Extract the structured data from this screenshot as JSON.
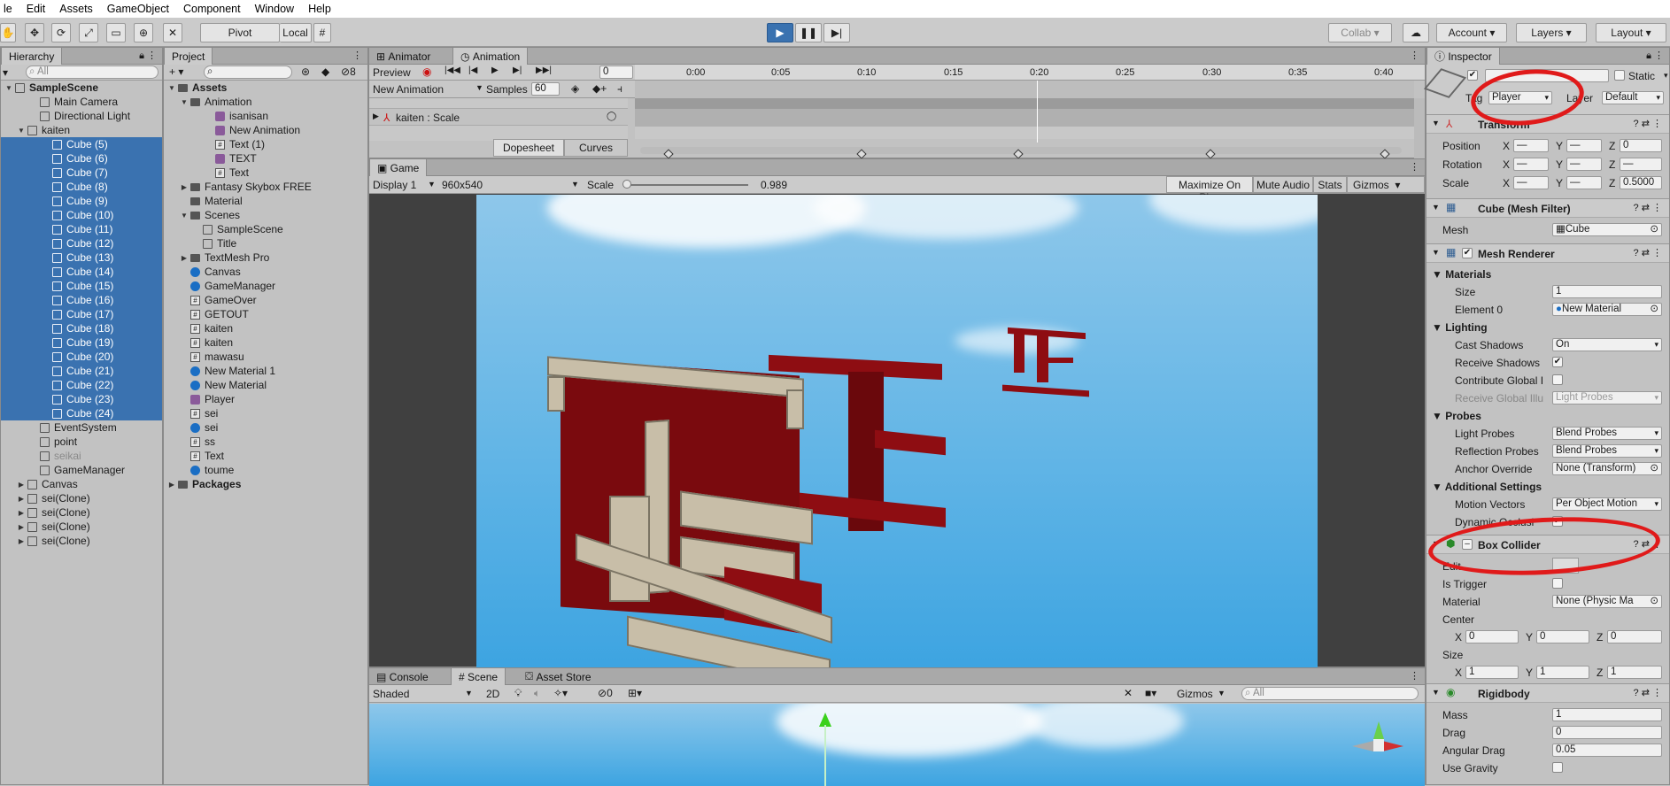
{
  "menu": [
    "le",
    "Edit",
    "Assets",
    "GameObject",
    "Component",
    "Window",
    "Help"
  ],
  "toolbar": {
    "pivot": "Pivot",
    "local": "Local",
    "collab": "Collab ▾",
    "account": "Account",
    "layers": "Layers",
    "layout": "Layout"
  },
  "hierarchy": {
    "title": "Hierarchy",
    "search": "All",
    "rows": [
      {
        "label": "SampleScene",
        "bold": true,
        "indent": 0,
        "arrow": "▼",
        "sel": false,
        "icon": "cube"
      },
      {
        "label": "Main Camera",
        "indent": 2,
        "arrow": "",
        "sel": false,
        "icon": "cube"
      },
      {
        "label": "Directional Light",
        "indent": 2,
        "arrow": "",
        "sel": false,
        "icon": "cube"
      },
      {
        "label": "kaiten",
        "indent": 1,
        "arrow": "▼",
        "sel": false,
        "icon": "cube"
      },
      {
        "label": "Cube (5)",
        "indent": 3,
        "arrow": "",
        "sel": true,
        "icon": "cube"
      },
      {
        "label": "Cube (6)",
        "indent": 3,
        "arrow": "",
        "sel": true,
        "icon": "cube"
      },
      {
        "label": "Cube (7)",
        "indent": 3,
        "arrow": "",
        "sel": true,
        "icon": "cube"
      },
      {
        "label": "Cube (8)",
        "indent": 3,
        "arrow": "",
        "sel": true,
        "icon": "cube"
      },
      {
        "label": "Cube (9)",
        "indent": 3,
        "arrow": "",
        "sel": true,
        "icon": "cube"
      },
      {
        "label": "Cube (10)",
        "indent": 3,
        "arrow": "",
        "sel": true,
        "icon": "cube"
      },
      {
        "label": "Cube (11)",
        "indent": 3,
        "arrow": "",
        "sel": true,
        "icon": "cube"
      },
      {
        "label": "Cube (12)",
        "indent": 3,
        "arrow": "",
        "sel": true,
        "icon": "cube"
      },
      {
        "label": "Cube (13)",
        "indent": 3,
        "arrow": "",
        "sel": true,
        "icon": "cube"
      },
      {
        "label": "Cube (14)",
        "indent": 3,
        "arrow": "",
        "sel": true,
        "icon": "cube"
      },
      {
        "label": "Cube (15)",
        "indent": 3,
        "arrow": "",
        "sel": true,
        "icon": "cube"
      },
      {
        "label": "Cube (16)",
        "indent": 3,
        "arrow": "",
        "sel": true,
        "icon": "cube"
      },
      {
        "label": "Cube (17)",
        "indent": 3,
        "arrow": "",
        "sel": true,
        "icon": "cube"
      },
      {
        "label": "Cube (18)",
        "indent": 3,
        "arrow": "",
        "sel": true,
        "icon": "cube"
      },
      {
        "label": "Cube (19)",
        "indent": 3,
        "arrow": "",
        "sel": true,
        "icon": "cube"
      },
      {
        "label": "Cube (20)",
        "indent": 3,
        "arrow": "",
        "sel": true,
        "icon": "cube"
      },
      {
        "label": "Cube (21)",
        "indent": 3,
        "arrow": "",
        "sel": true,
        "icon": "cube"
      },
      {
        "label": "Cube (22)",
        "indent": 3,
        "arrow": "",
        "sel": true,
        "icon": "cube"
      },
      {
        "label": "Cube (23)",
        "indent": 3,
        "arrow": "",
        "sel": true,
        "icon": "cube"
      },
      {
        "label": "Cube (24)",
        "indent": 3,
        "arrow": "",
        "sel": true,
        "icon": "cube"
      },
      {
        "label": "EventSystem",
        "indent": 2,
        "arrow": "",
        "sel": false,
        "icon": "cube"
      },
      {
        "label": "point",
        "indent": 2,
        "arrow": "",
        "sel": false,
        "icon": "cube"
      },
      {
        "label": "seikai",
        "indent": 2,
        "arrow": "",
        "sel": false,
        "icon": "cube",
        "dim": true
      },
      {
        "label": "GameManager",
        "indent": 2,
        "arrow": "",
        "sel": false,
        "icon": "cube"
      },
      {
        "label": "Canvas",
        "indent": 1,
        "arrow": "▶",
        "sel": false,
        "icon": "cube"
      },
      {
        "label": "sei(Clone)",
        "indent": 1,
        "arrow": "▶",
        "sel": false,
        "icon": "cube"
      },
      {
        "label": "sei(Clone)",
        "indent": 1,
        "arrow": "▶",
        "sel": false,
        "icon": "cube"
      },
      {
        "label": "sei(Clone)",
        "indent": 1,
        "arrow": "▶",
        "sel": false,
        "icon": "cube"
      },
      {
        "label": "sei(Clone)",
        "indent": 1,
        "arrow": "▶",
        "sel": false,
        "icon": "cube"
      }
    ]
  },
  "project": {
    "title": "Project",
    "add": "+ ▾",
    "hidden_count": "8",
    "rows": [
      {
        "label": "Assets",
        "bold": true,
        "indent": 0,
        "arrow": "▼",
        "icon": "folder"
      },
      {
        "label": "Animation",
        "indent": 1,
        "arrow": "▼",
        "icon": "folder"
      },
      {
        "label": "isanisan",
        "indent": 3,
        "arrow": "",
        "icon": "anim"
      },
      {
        "label": "New Animation",
        "indent": 3,
        "arrow": "",
        "icon": "anim"
      },
      {
        "label": "Text (1)",
        "indent": 3,
        "arrow": "",
        "icon": "script"
      },
      {
        "label": "TEXT",
        "indent": 3,
        "arrow": "",
        "icon": "anim"
      },
      {
        "label": "Text",
        "indent": 3,
        "arrow": "",
        "icon": "script"
      },
      {
        "label": "Fantasy Skybox FREE",
        "indent": 1,
        "arrow": "▶",
        "icon": "folder"
      },
      {
        "label": "Material",
        "indent": 1,
        "arrow": "",
        "icon": "folder"
      },
      {
        "label": "Scenes",
        "indent": 1,
        "arrow": "▼",
        "icon": "folder"
      },
      {
        "label": "SampleScene",
        "indent": 2,
        "arrow": "",
        "icon": "cube"
      },
      {
        "label": "Title",
        "indent": 2,
        "arrow": "",
        "icon": "cube"
      },
      {
        "label": "TextMesh Pro",
        "indent": 1,
        "arrow": "▶",
        "icon": "folder"
      },
      {
        "label": "Canvas",
        "indent": 1,
        "arrow": "",
        "icon": "sphere"
      },
      {
        "label": "GameManager",
        "indent": 1,
        "arrow": "",
        "icon": "sphere"
      },
      {
        "label": "GameOver",
        "indent": 1,
        "arrow": "",
        "icon": "script"
      },
      {
        "label": "GETOUT",
        "indent": 1,
        "arrow": "",
        "icon": "script"
      },
      {
        "label": "kaiten",
        "indent": 1,
        "arrow": "",
        "icon": "script"
      },
      {
        "label": "kaiten",
        "indent": 1,
        "arrow": "",
        "icon": "script"
      },
      {
        "label": "mawasu",
        "indent": 1,
        "arrow": "",
        "icon": "script"
      },
      {
        "label": "New Material 1",
        "indent": 1,
        "arrow": "",
        "icon": "sphere"
      },
      {
        "label": "New Material",
        "indent": 1,
        "arrow": "",
        "icon": "sphere"
      },
      {
        "label": "Player",
        "indent": 1,
        "arrow": "",
        "icon": "anim"
      },
      {
        "label": "sei",
        "indent": 1,
        "arrow": "",
        "icon": "script"
      },
      {
        "label": "sei",
        "indent": 1,
        "arrow": "",
        "icon": "sphere"
      },
      {
        "label": "ss",
        "indent": 1,
        "arrow": "",
        "icon": "script"
      },
      {
        "label": "Text",
        "indent": 1,
        "arrow": "",
        "icon": "script"
      },
      {
        "label": "toume",
        "indent": 1,
        "arrow": "",
        "icon": "sphere"
      },
      {
        "label": "Packages",
        "bold": true,
        "indent": 0,
        "arrow": "▶",
        "icon": "folder"
      }
    ]
  },
  "animation": {
    "tab_animator": "Animator",
    "tab_animation": "Animation",
    "preview": "Preview",
    "frame": "0",
    "clip": "New Animation",
    "samples_label": "Samples",
    "samples": "60",
    "property": "kaiten : Scale",
    "dopesheet": "Dopesheet",
    "curves": "Curves",
    "times": [
      "0:00",
      "0:05",
      "0:10",
      "0:15",
      "0:20",
      "0:25",
      "0:30",
      "0:35",
      "0:40"
    ]
  },
  "game": {
    "tab": "Game",
    "display": "Display 1",
    "resolution": "960x540",
    "scale_label": "Scale",
    "scale_value": "0.989",
    "maximize": "Maximize On Play",
    "mute": "Mute Audio",
    "stats": "Stats",
    "gizmos": "Gizmos"
  },
  "scene": {
    "tab_console": "Console",
    "tab_scene": "Scene",
    "tab_store": "Asset Store",
    "shading": "Shaded",
    "mode2d": "2D",
    "hidden": "0",
    "gizmos": "Gizmos",
    "search": "All"
  },
  "inspector": {
    "title": "Inspector",
    "static": "Static",
    "tag_label": "Tag",
    "tag": "Player",
    "layer_label": "Layer",
    "layer": "Default",
    "transform": {
      "title": "Transform",
      "position": "Position",
      "rotation": "Rotation",
      "scale": "Scale",
      "pos": [
        "—",
        "—",
        "0"
      ],
      "rot": [
        "—",
        "—",
        "—"
      ],
      "scl": [
        "—",
        "—",
        "0.5000"
      ]
    },
    "meshfilter": {
      "title": "Cube (Mesh Filter)",
      "mesh_label": "Mesh",
      "mesh": "Cube"
    },
    "renderer": {
      "title": "Mesh Renderer",
      "materials": "Materials",
      "size_label": "Size",
      "size": "1",
      "el_label": "Element 0",
      "el": "New Material",
      "lighting": "Lighting",
      "cast_label": "Cast Shadows",
      "cast": "On",
      "receive_label": "Receive Shadows",
      "contrib_label": "Contribute Global I",
      "rgi_label": "Receive Global Illu",
      "rgi": "Light Probes",
      "probes": "Probes",
      "lp_label": "Light Probes",
      "lp": "Blend Probes",
      "rp_label": "Reflection Probes",
      "rp": "Blend Probes",
      "ao_label": "Anchor Override",
      "ao": "None (Transform)",
      "additional": "Additional Settings",
      "mv_label": "Motion Vectors",
      "mv": "Per Object Motion",
      "dyn_label": "Dynamic Occlusi"
    },
    "collider": {
      "title": "Box Collider",
      "edit_label": "Edit",
      "trigger_label": "Is Trigger",
      "mat_label": "Material",
      "mat": "None (Physic Ma",
      "center_label": "Center",
      "center": [
        "0",
        "0",
        "0"
      ],
      "size_label": "Size",
      "size": [
        "1",
        "1",
        "1"
      ]
    },
    "rigidbody": {
      "title": "Rigidbody",
      "mass_label": "Mass",
      "mass": "1",
      "drag_label": "Drag",
      "drag": "0",
      "adrag_label": "Angular Drag",
      "adrag": "0.05",
      "grav_label": "Use Gravity"
    }
  },
  "colors": {
    "selection": "#3a72b0",
    "panel": "#c2c2c2",
    "sky": "#62b5e6",
    "red": "#8e0d12",
    "annotation": "#e01a1a"
  }
}
